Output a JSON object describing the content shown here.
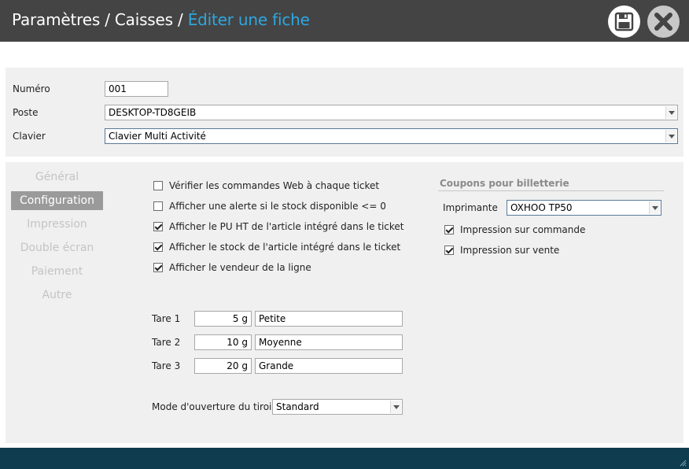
{
  "header": {
    "crumb_1": "Paramètres",
    "separator_1": " / ",
    "crumb_2": "Caisses",
    "separator_2": " / ",
    "crumb_3": "Éditer une fiche",
    "save_icon": "floppy-disk-icon",
    "close_icon": "close-x-icon"
  },
  "form": {
    "numero_label": "Numéro",
    "numero_value": "001",
    "poste_label": "Poste",
    "poste_value": "DESKTOP-TD8GEIB",
    "clavier_label": "Clavier",
    "clavier_value": "Clavier Multi Activité"
  },
  "nav": [
    {
      "label": "Général"
    },
    {
      "label": "Configuration",
      "selected": true
    },
    {
      "label": "Impression"
    },
    {
      "label": "Double écran"
    },
    {
      "label": "Paiement"
    },
    {
      "label": "Autre"
    }
  ],
  "options": [
    {
      "label": "Vérifier les commandes Web à chaque ticket",
      "checked": false
    },
    {
      "label": "Afficher une alerte si le stock disponible <= 0",
      "checked": false
    },
    {
      "label": "Afficher le PU HT de l'article intégré dans le ticket",
      "checked": true
    },
    {
      "label": "Afficher le stock de l'article intégré dans le ticket",
      "checked": true
    },
    {
      "label": "Afficher le vendeur de la ligne",
      "checked": true
    }
  ],
  "tares": [
    {
      "label": "Tare 1",
      "weight": "5 g",
      "name": "Petite"
    },
    {
      "label": "Tare 2",
      "weight": "10 g",
      "name": "Moyenne"
    },
    {
      "label": "Tare 3",
      "weight": "20 g",
      "name": "Grande"
    }
  ],
  "drawer": {
    "label": "Mode d'ouverture du tiroir",
    "value": "Standard"
  },
  "coupons": {
    "title": "Coupons pour billetterie",
    "printer_label": "Imprimante",
    "printer_value": "OXHOO TP50",
    "opt_commande": {
      "label": "Impression sur commande",
      "checked": true
    },
    "opt_vente": {
      "label": "Impression sur vente",
      "checked": true
    }
  },
  "colors": {
    "titlebar": "#444444",
    "accent": "#2ea7e0",
    "footer": "#0f3d4f",
    "panel": "#f0f0f0"
  }
}
